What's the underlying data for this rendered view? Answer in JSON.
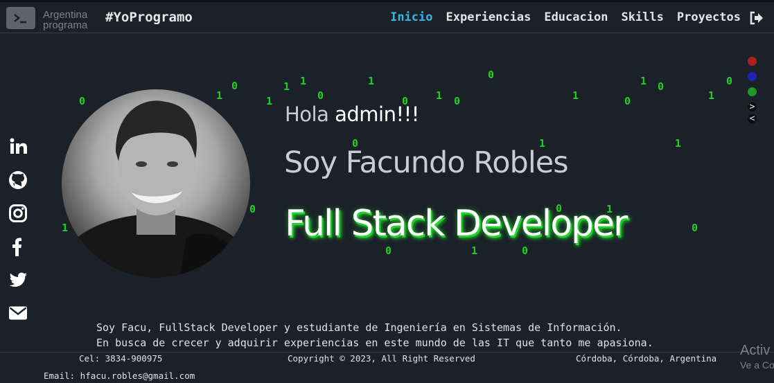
{
  "navbar": {
    "brand_line1": "Argentina",
    "brand_line2": "programa",
    "hashtag": "#YoProgramo",
    "links": [
      {
        "label": "Inicio",
        "active": true
      },
      {
        "label": "Experiencias",
        "active": false
      },
      {
        "label": "Educacion",
        "active": false
      },
      {
        "label": "Skills",
        "active": false
      },
      {
        "label": "Proyectos",
        "active": false
      }
    ],
    "logout_icon": "sign-out-icon",
    "logo_icon": "terminal-icon"
  },
  "social": [
    "linkedin-icon",
    "github-icon",
    "instagram-icon",
    "facebook-icon",
    "twitter-icon",
    "envelope-icon"
  ],
  "hero": {
    "greeting_prefix": "Hola ",
    "username": "admin!!!",
    "name": "Soy Facundo Robles",
    "role": "Full Stack Developer"
  },
  "theme_dots": {
    "colors": [
      "#b01d1d",
      "#1f22b3",
      "#1d9a26"
    ],
    "next_label": ">",
    "prev_label": "<"
  },
  "binary_rain": [
    "0",
    "1",
    "0",
    "1",
    "1",
    "0",
    "1",
    "1",
    "0",
    "1",
    "0",
    "0",
    "1",
    "0",
    "1",
    "0",
    "0",
    "1",
    "1",
    "0",
    "1",
    "0",
    "1",
    "0",
    "1",
    "0",
    "0",
    "1",
    "0"
  ],
  "about": {
    "line1": "Soy Facu, FullStack Developer y estudiante de Ingeniería en Sistemas de Información.",
    "line2": "En busca de crecer y adquirir experiencias en este mundo de las IT que tanto me apasiona."
  },
  "footer": {
    "phone": "Cel: 3834-900975",
    "copyright": "Copyright © 2023, All Right Reserved",
    "location": "Córdoba, Córdoba, Argentina",
    "email": "Email: hfacu.robles@gmail.com"
  },
  "watermark": {
    "line1": "Activ",
    "line2": "Ve a Co"
  }
}
